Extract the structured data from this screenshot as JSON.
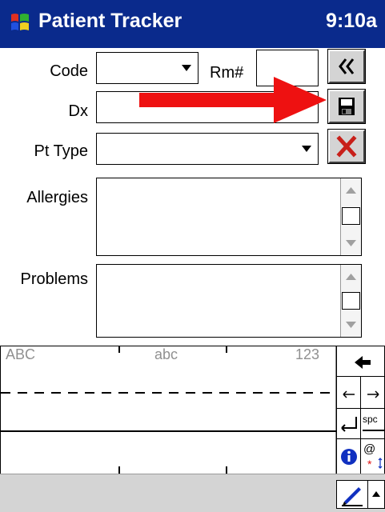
{
  "app": {
    "title": "Patient Tracker",
    "time": "9:10a"
  },
  "form": {
    "code_label": "Code",
    "code_value": "",
    "room_label": "Rm#",
    "room_value": "",
    "dx_label": "Dx",
    "dx_value": "",
    "pt_type_label": "Pt Type",
    "pt_type_value": "",
    "allergies_label": "Allergies",
    "allergies_value": "",
    "problems_label": "Problems",
    "problems_value": ""
  },
  "buttons": {
    "back_glyph": "«",
    "save_icon": "floppy-disk-icon",
    "delete_icon": "red-x-icon"
  },
  "annotation": {
    "arrow_color": "#ee1111",
    "points_to": "save-button"
  },
  "keyboard": {
    "mode_upper": "ABC",
    "mode_lower": "abc",
    "mode_numeric": "123",
    "space_label": "spc",
    "symbols_label": "@"
  },
  "colors": {
    "titlebar": "#0a2a8c",
    "menubar": "#d4d4d4"
  }
}
